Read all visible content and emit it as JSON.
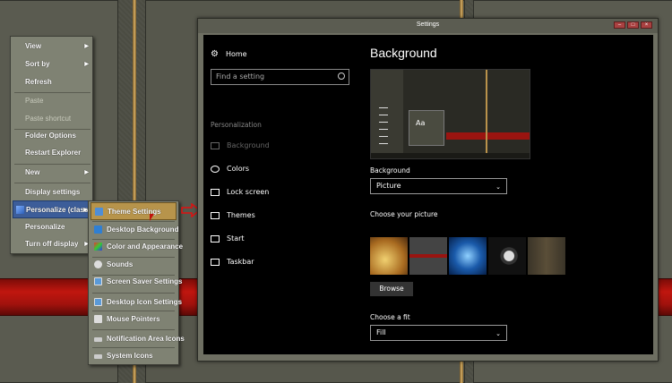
{
  "context_menu": {
    "items": [
      {
        "label": "View",
        "submenu": true,
        "disabled": false
      },
      {
        "label": "Sort by",
        "submenu": true,
        "disabled": false
      },
      {
        "label": "Refresh",
        "submenu": false,
        "disabled": false
      },
      {
        "label": "Paste",
        "submenu": false,
        "disabled": true
      },
      {
        "label": "Paste shortcut",
        "submenu": false,
        "disabled": true
      },
      {
        "label": "Folder Options",
        "submenu": false,
        "disabled": false
      },
      {
        "label": "Restart Explorer",
        "submenu": false,
        "disabled": false
      },
      {
        "label": "New",
        "submenu": true,
        "disabled": false
      },
      {
        "label": "Display settings",
        "submenu": false,
        "disabled": false
      },
      {
        "label": "Personalize (classic)",
        "submenu": true,
        "disabled": false,
        "highlighted": true
      },
      {
        "label": "Personalize",
        "submenu": false,
        "disabled": false
      },
      {
        "label": "Turn off display",
        "submenu": true,
        "disabled": false
      }
    ]
  },
  "submenu": {
    "items": [
      {
        "label": "Theme Settings",
        "icon": "theme-icon",
        "highlighted": true
      },
      {
        "label": "Desktop Background",
        "icon": "desktop-background-icon"
      },
      {
        "label": "Color and Appearance",
        "icon": "color-icon"
      },
      {
        "label": "Sounds",
        "icon": "sounds-icon"
      },
      {
        "label": "Screen Saver Settings",
        "icon": "screensaver-icon"
      },
      {
        "label": "Desktop Icon Settings",
        "icon": "desktop-icons-icon"
      },
      {
        "label": "Mouse Pointers",
        "icon": "mouse-icon"
      },
      {
        "label": "Notification Area Icons",
        "icon": "notification-icon"
      },
      {
        "label": "System Icons",
        "icon": "system-icons-icon"
      }
    ]
  },
  "settings_window": {
    "title": "Settings",
    "nav": {
      "home": "Home",
      "search_placeholder": "Find a setting",
      "section": "Personalization",
      "items": [
        {
          "label": "Background",
          "icon": "image-icon",
          "active": true
        },
        {
          "label": "Colors",
          "icon": "palette-icon"
        },
        {
          "label": "Lock screen",
          "icon": "lock-screen-icon"
        },
        {
          "label": "Themes",
          "icon": "themes-icon"
        },
        {
          "label": "Start",
          "icon": "start-icon"
        },
        {
          "label": "Taskbar",
          "icon": "taskbar-icon"
        }
      ]
    },
    "content": {
      "heading": "Background",
      "preview_sample_text": "Aa",
      "background_label": "Background",
      "background_value": "Picture",
      "choose_picture_label": "Choose your picture",
      "browse_label": "Browse",
      "fit_label": "Choose a fit",
      "fit_value": "Fill"
    }
  },
  "colors": {
    "accent_gold": "#b7944b",
    "highlight_blue": "#3c5d99",
    "red_band": "#c0160f"
  }
}
